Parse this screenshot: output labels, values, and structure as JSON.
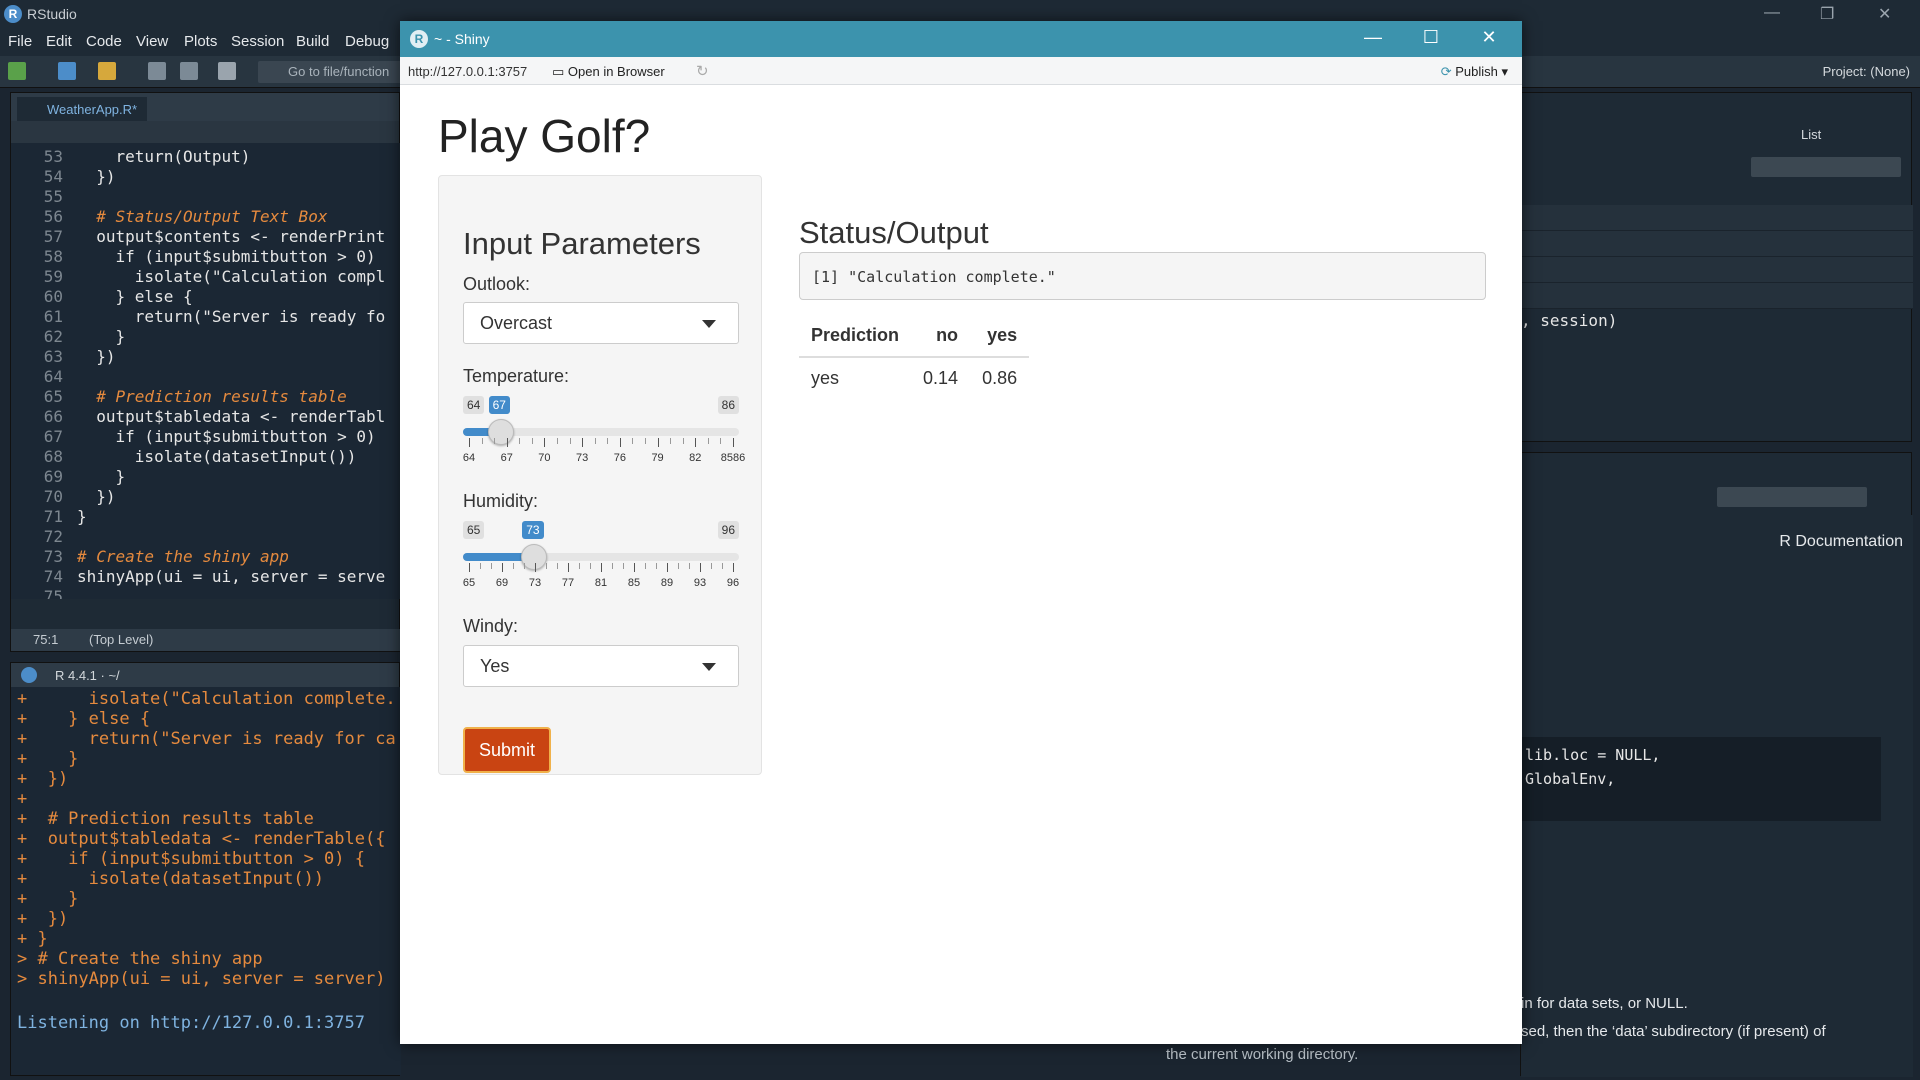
{
  "rstudio": {
    "title": "RStudio",
    "menu": [
      "File",
      "Edit",
      "Code",
      "View",
      "Plots",
      "Session",
      "Build",
      "Debug"
    ],
    "goto_placeholder": "Go to file/function",
    "project": "Project: (None)",
    "editor_tab": "WeatherApp.R*",
    "cursor_pos": "75:1",
    "scope": "(Top Level)",
    "console_title": "R 4.4.1 · ~/",
    "list_label": "List",
    "help_source": "R Documentation",
    "right_code_fragment": ", session)",
    "right_doc_code1": "lib.loc = NULL,",
    "right_doc_code2": "GlobalEnv,",
    "right_doc_text1": "in for data sets, or NULL.",
    "right_doc_text2": "sed, then the ‘data’ subdirectory (if present) of",
    "right_doc_text3": "the current working directory."
  },
  "code": [
    {
      "n": "53",
      "t": "    return(Output)"
    },
    {
      "n": "54",
      "t": "  })"
    },
    {
      "n": "55",
      "t": ""
    },
    {
      "n": "56",
      "t": "  # Status/Output Text Box"
    },
    {
      "n": "57",
      "t": "  output$contents <- renderPrint"
    },
    {
      "n": "58",
      "t": "    if (input$submitbutton > 0)"
    },
    {
      "n": "59",
      "t": "      isolate(\"Calculation compl"
    },
    {
      "n": "60",
      "t": "    } else {"
    },
    {
      "n": "61",
      "t": "      return(\"Server is ready fo"
    },
    {
      "n": "62",
      "t": "    }"
    },
    {
      "n": "63",
      "t": "  })"
    },
    {
      "n": "64",
      "t": ""
    },
    {
      "n": "65",
      "t": "  # Prediction results table"
    },
    {
      "n": "66",
      "t": "  output$tabledata <- renderTabl"
    },
    {
      "n": "67",
      "t": "    if (input$submitbutton > 0)"
    },
    {
      "n": "68",
      "t": "      isolate(datasetInput())"
    },
    {
      "n": "69",
      "t": "    }"
    },
    {
      "n": "70",
      "t": "  })"
    },
    {
      "n": "71",
      "t": "}"
    },
    {
      "n": "72",
      "t": ""
    },
    {
      "n": "73",
      "t": "# Create the shiny app"
    },
    {
      "n": "74",
      "t": "shinyApp(ui = ui, server = serve"
    },
    {
      "n": "75",
      "t": ""
    }
  ],
  "console": [
    "+      isolate(\"Calculation complete.",
    "+    } else {",
    "+      return(\"Server is ready for ca",
    "+    }",
    "+  })",
    "+",
    "+  # Prediction results table",
    "+  output$tabledata <- renderTable({",
    "+    if (input$submitbutton > 0) {",
    "+      isolate(datasetInput())",
    "+    }",
    "+  })",
    "+ }",
    "> # Create the shiny app",
    "> shinyApp(ui = ui, server = server)",
    "",
    "Listening on http://127.0.0.1:3757"
  ],
  "shiny": {
    "window_title": "~ - Shiny",
    "url": "http://127.0.0.1:3757",
    "open_browser": "Open in Browser",
    "publish": "Publish",
    "app_title": "Play Golf?",
    "input_title": "Input Parameters",
    "outlook_label": "Outlook:",
    "outlook_value": "Overcast",
    "temperature_label": "Temperature:",
    "temperature": {
      "min": "64",
      "max": "86",
      "value": "67",
      "min_n": 64,
      "max_n": 86,
      "value_n": 67,
      "tick_labels": [
        "64",
        "67",
        "70",
        "73",
        "76",
        "79",
        "82",
        "8586"
      ]
    },
    "humidity_label": "Humidity:",
    "humidity": {
      "min": "65",
      "max": "96",
      "value": "73",
      "min_n": 65,
      "max_n": 96,
      "value_n": 73,
      "tick_labels": [
        "65",
        "69",
        "73",
        "77",
        "81",
        "85",
        "89",
        "93",
        "96"
      ]
    },
    "windy_label": "Windy:",
    "windy_value": "Yes",
    "submit": "Submit",
    "status_title": "Status/Output",
    "status_text": "[1] \"Calculation complete.\"",
    "table": {
      "headers": [
        "Prediction",
        "no",
        "yes"
      ],
      "rows": [
        [
          "yes",
          "0.14",
          "0.86"
        ]
      ]
    }
  },
  "colors": {
    "accent": "#428bca",
    "submit": "#c94412",
    "titlebar": "#3c93ad"
  }
}
